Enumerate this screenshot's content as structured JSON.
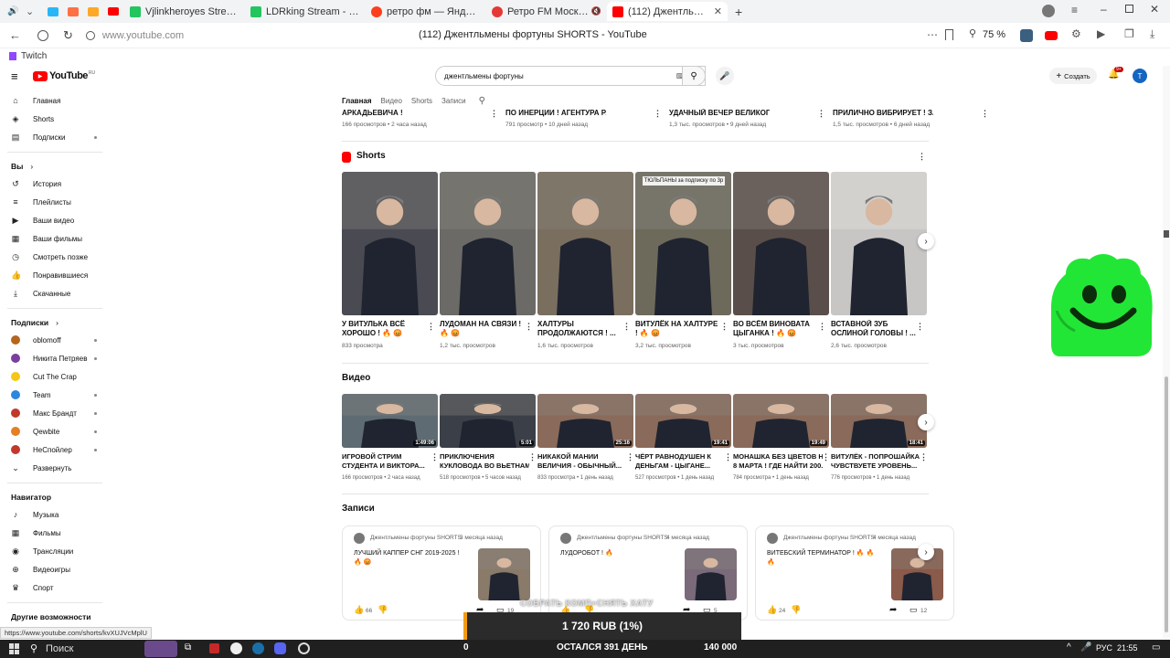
{
  "browser": {
    "tabs": [
      {
        "label": "Vjlinkheroyes Stream - Wa",
        "color": "#22c55e",
        "active": false
      },
      {
        "label": "LDRking Stream - Watch L",
        "color": "#22c55e",
        "active": false
      },
      {
        "label": "ретро фм — Яндекс: наш",
        "color": "#fc3f1d",
        "active": false
      },
      {
        "label": "Ретро FM Москва -",
        "color": "#e53935",
        "active": false
      },
      {
        "label": "(112) Джентльмены ф",
        "color": "#ff0000",
        "active": true
      }
    ],
    "url": "www.youtube.com",
    "page_title": "(112) Джентльмены фортуны SHORTS - YouTube",
    "zoom": "75 %",
    "bookmark": "Twitch",
    "status_url": "https://www.youtube.com/shorts/kvXUJVcMplU"
  },
  "youtube": {
    "logo": "YouTube",
    "region": "RU",
    "search_value": "джентльмены фортуны",
    "create_label": "Создать",
    "notif_badge": "9+",
    "avatar_letter": "T"
  },
  "sidebar": {
    "main": [
      {
        "label": "Главная",
        "icon": "home-icon",
        "glyph": "⌂"
      },
      {
        "label": "Shorts",
        "icon": "shorts-icon",
        "glyph": "◈"
      },
      {
        "label": "Подписки",
        "icon": "subscriptions-icon",
        "glyph": "▤"
      }
    ],
    "you_label": "Вы",
    "you": [
      {
        "label": "История",
        "icon": "history-icon",
        "glyph": "↺"
      },
      {
        "label": "Плейлисты",
        "icon": "playlists-icon",
        "glyph": "≡"
      },
      {
        "label": "Ваши видео",
        "icon": "your-videos-icon",
        "glyph": "▶"
      },
      {
        "label": "Ваши фильмы",
        "icon": "your-movies-icon",
        "glyph": "▦"
      },
      {
        "label": "Смотреть позже",
        "icon": "watch-later-icon",
        "glyph": "◷"
      },
      {
        "label": "Понравившиеся",
        "icon": "liked-icon",
        "glyph": "👍"
      },
      {
        "label": "Скачанные",
        "icon": "downloads-icon",
        "glyph": "⤓"
      }
    ],
    "subs_label": "Подписки",
    "subs": [
      {
        "label": "oblomoff",
        "color": "#b5651d"
      },
      {
        "label": "Никита Петряев",
        "color": "#7b3fa0"
      },
      {
        "label": "Cut The Crap",
        "color": "#f5c518"
      },
      {
        "label": "Team",
        "color": "#2e86de"
      },
      {
        "label": "Макс Брандт",
        "color": "#c0392b"
      },
      {
        "label": "Qewbite",
        "color": "#e67e22"
      },
      {
        "label": "НеСпойлер",
        "color": "#c0392b"
      }
    ],
    "expand_label": "Развернуть",
    "nav_label": "Навигатор",
    "nav": [
      {
        "label": "Музыка",
        "icon": "music-icon",
        "glyph": "♪"
      },
      {
        "label": "Фильмы",
        "icon": "movies-icon",
        "glyph": "▦"
      },
      {
        "label": "Трансляции",
        "icon": "live-icon",
        "glyph": "◉"
      },
      {
        "label": "Видеоигры",
        "icon": "gaming-icon",
        "glyph": "⊕"
      },
      {
        "label": "Спорт",
        "icon": "sport-icon",
        "glyph": "♛"
      }
    ],
    "more_label": "Другие возможности"
  },
  "channel_tabs": [
    "Главная",
    "Видео",
    "Shorts",
    "Записи"
  ],
  "top_row": [
    {
      "title": "АРКАДЬЕВИЧА !",
      "meta": "166 просмотров • 2 часа назад"
    },
    {
      "title": "ПО ИНЕРЦИИ ! АГЕНТУРА РАБОТАЕТ...",
      "meta": "791 просмотр • 10 дней назад"
    },
    {
      "title": "УДАЧНЫЙ ВЕЧЕР ВЕЛИКОГО СРУЛЯ !",
      "meta": "1,3 тыс. просмотров • 9 дней назад"
    },
    {
      "title": "ПРИЛИЧНО ВИБРИРУЕТ ! ЗА ПО",
      "meta": "1,5 тыс. просмотров • 6 дней назад"
    }
  ],
  "shorts_section": "Shorts",
  "shorts": [
    {
      "line1": "У ВИТУЛЬКА ВСЁ",
      "line2": "ХОРОШО ! 🔥 😡",
      "views": "833 просмотра",
      "bg": "#4a4a52",
      "overlay": ""
    },
    {
      "line1": "ЛУДОМАН НА СВЯЗИ !",
      "line2": "🔥 😡",
      "views": "1,2 тыс. просмотров",
      "bg": "#6b6a66",
      "overlay": ""
    },
    {
      "line1": "ХАЛТУРЫ",
      "line2": "ПРОДОЛЖАЮТСЯ ! ...",
      "views": "1,6 тыс. просмотров",
      "bg": "#7a6e5e",
      "overlay": ""
    },
    {
      "line1": "ВИТУЛЁК НА ХАЛТУРЕ",
      "line2": "! 🔥 😡",
      "views": "3,2 тыс. просмотров",
      "bg": "#6d6a5c",
      "overlay": "ТЮЛЬПАНЫ за подписку по 3р"
    },
    {
      "line1": "ВО ВСЁМ ВИНОВАТА",
      "line2": "ЦЫГАНКА ! 🔥 😡",
      "views": "3 тыс. просмотров",
      "bg": "#5a4e4a",
      "overlay": ""
    },
    {
      "line1": "ВСТАВНОЙ ЗУБ",
      "line2": "ОСЛИНОЙ ГОЛОВЫ ! ...",
      "views": "2,6 тыс. просмотров",
      "bg": "#c8c6c4",
      "overlay": ""
    }
  ],
  "videos_section": "Видео",
  "videos": [
    {
      "line1": "ИГРОВОЙ СТРИМ",
      "line2": "СТУДЕНТА И ВИКТОРА...",
      "meta": "166 просмотров • 2 часа назад",
      "dur": "1:49:06",
      "bg": "#5e6b72"
    },
    {
      "line1": "ПРИКЛЮЧЕНИЯ",
      "line2": "КУКЛОВОДА ВО ВЬЕТНАМ...",
      "meta": "518 просмотров • 5 часов назад",
      "dur": "5:01",
      "bg": "#3b4048"
    },
    {
      "line1": "НИКАКОЙ МАНИИ",
      "line2": "ВЕЛИЧИЯ - ОБЫЧНЫЙ...",
      "meta": "833 просмотра • 1 день назад",
      "dur": "25:16",
      "bg": "#8a6a5a"
    },
    {
      "line1": "ЧЁРТ РАВНОДУШЕН К",
      "line2": "ДЕНЬГАМ - ЦЫГАНЕ...",
      "meta": "527 просмотров • 1 день назад",
      "dur": "19:41",
      "bg": "#8a6a5a"
    },
    {
      "line1": "МОНАШКА БЕЗ ЦВЕТОВ НА",
      "line2": "8 МАРТА ! ГДЕ НАЙТИ 200...",
      "meta": "784 просмотра • 1 день назад",
      "dur": "19:49",
      "bg": "#8a6a5a"
    },
    {
      "line1": "ВИТУЛЁК - ПОПРОШАЙКА !",
      "line2": "ЧУВСТВУЕТЕ УРОВЕНЬ...",
      "meta": "776 просмотров • 1 день назад",
      "dur": "18:41",
      "bg": "#8a6a5a"
    }
  ],
  "posts_section": "Записи",
  "posts": [
    {
      "author": "Джентльмены фортуны SHORTS",
      "time": "3 месяца назад",
      "text": "ЛУЧШИЙ КАППЕР СНГ 2019-2025 ! 🔥 😡",
      "likes": "66",
      "comments": "19",
      "bg": "#8a7a6a"
    },
    {
      "author": "Джентльмены фортуны SHORTS",
      "time": "4 месяца назад",
      "text": "ЛУДОРОБОТ ! 🔥",
      "likes": "",
      "comments": "5",
      "bg": "#7a6a7a"
    },
    {
      "author": "Джентльмены фортуны SHORTS",
      "time": "4 месяца назад",
      "text": "ВИТЕБСКИЙ ТЕРМИНАТОР ! 🔥 🔥 🔥",
      "likes": "24",
      "comments": "12",
      "bg": "#8a5a4a"
    }
  ],
  "donation": {
    "overlay_text": "СОБРАТЬ КОМП+СНЯТЬ ХАТУ",
    "amount": "1 720 RUB (1%)",
    "start": "0",
    "remaining": "ОСТАЛСЯ 391 ДЕНЬ",
    "goal": "140 000"
  },
  "taskbar": {
    "search": "Поиск",
    "lang": "РУС",
    "time": "21:55"
  },
  "colors": {
    "yt_red": "#ff0000",
    "mascot_green": "#22e636",
    "avatar_blue": "#1565c0"
  }
}
